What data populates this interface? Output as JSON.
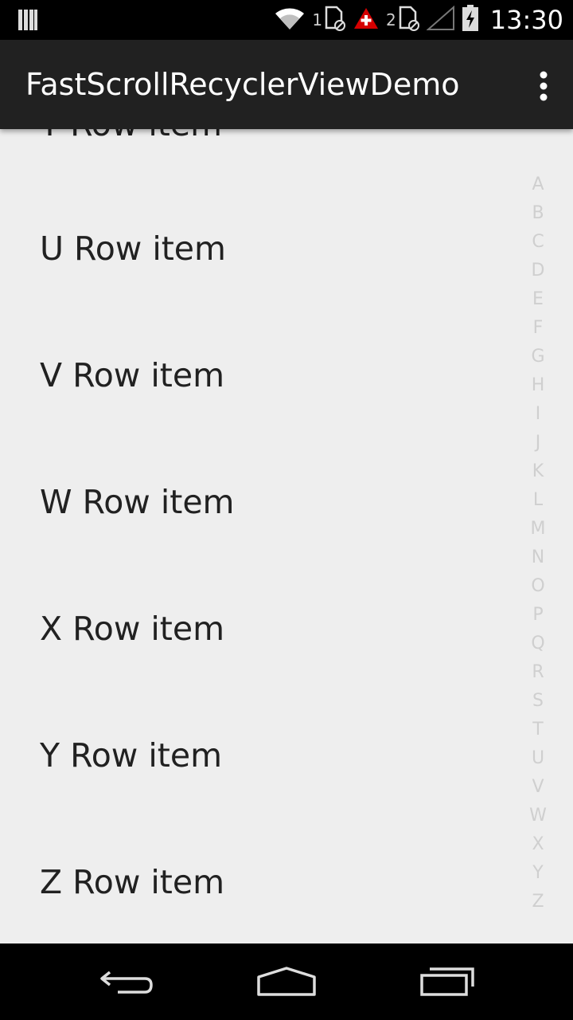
{
  "status_bar": {
    "sim1_number": "1",
    "sim2_number": "2",
    "time": "13:30"
  },
  "app_bar": {
    "title": "FastScrollRecyclerViewDemo"
  },
  "list": {
    "partial_item": "T Row item",
    "items": [
      "U Row item",
      "V Row item",
      "W Row item",
      "X Row item",
      "Y Row item",
      "Z Row item"
    ]
  },
  "index_bar": {
    "letters": [
      "A",
      "B",
      "C",
      "D",
      "E",
      "F",
      "G",
      "H",
      "I",
      "J",
      "K",
      "L",
      "M",
      "N",
      "O",
      "P",
      "Q",
      "R",
      "S",
      "T",
      "U",
      "V",
      "W",
      "X",
      "Y",
      "Z"
    ]
  },
  "colors": {
    "app_bar": "#212121",
    "background": "#eeeeee",
    "row_text": "#212121",
    "index_text": "#cfcfcf"
  }
}
